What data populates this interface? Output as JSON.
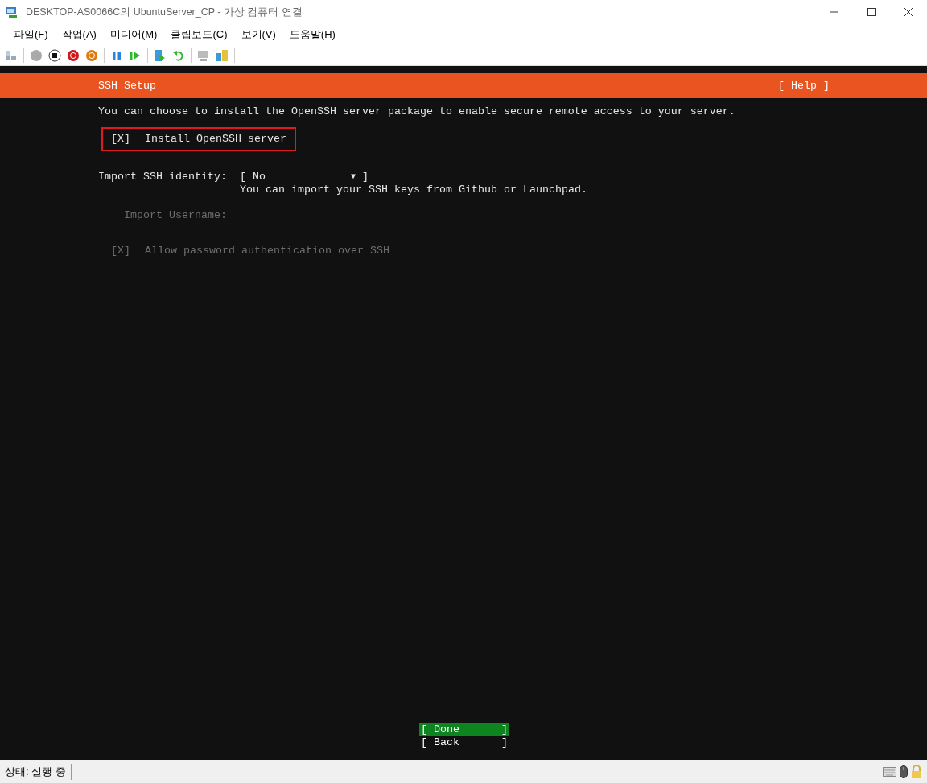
{
  "window": {
    "title": "DESKTOP-AS0066C의 UbuntuServer_CP - 가상 컴퓨터 연결"
  },
  "menu": [
    "파일(F)",
    "작업(A)",
    "미디어(M)",
    "클립보드(C)",
    "보기(V)",
    "도움말(H)"
  ],
  "console": {
    "header": {
      "title": "SSH Setup",
      "help": "[ Help ]"
    },
    "intro": "You can choose to install the OpenSSH server package to enable secure remote access to your server.",
    "install_option": {
      "box": "[X]",
      "label": "Install OpenSSH server",
      "disabled": false,
      "highlighted": true
    },
    "identity": {
      "label": "Import SSH identity:",
      "left": "[",
      "value": "No",
      "arrow": "▼",
      "right": "]",
      "hint": "You can import your SSH keys from Github or Launchpad."
    },
    "username": {
      "label": "Import Username:",
      "disabled": true
    },
    "password_option": {
      "box": "[X]",
      "label": "Allow password authentication over SSH",
      "disabled": true,
      "highlighted": false
    },
    "buttons": [
      {
        "left": "[",
        "label": "Done",
        "right": "]",
        "selected": true
      },
      {
        "left": "[",
        "label": "Back",
        "right": "]",
        "selected": false
      }
    ]
  },
  "status_bar": {
    "text": "상태: 실행 중"
  }
}
